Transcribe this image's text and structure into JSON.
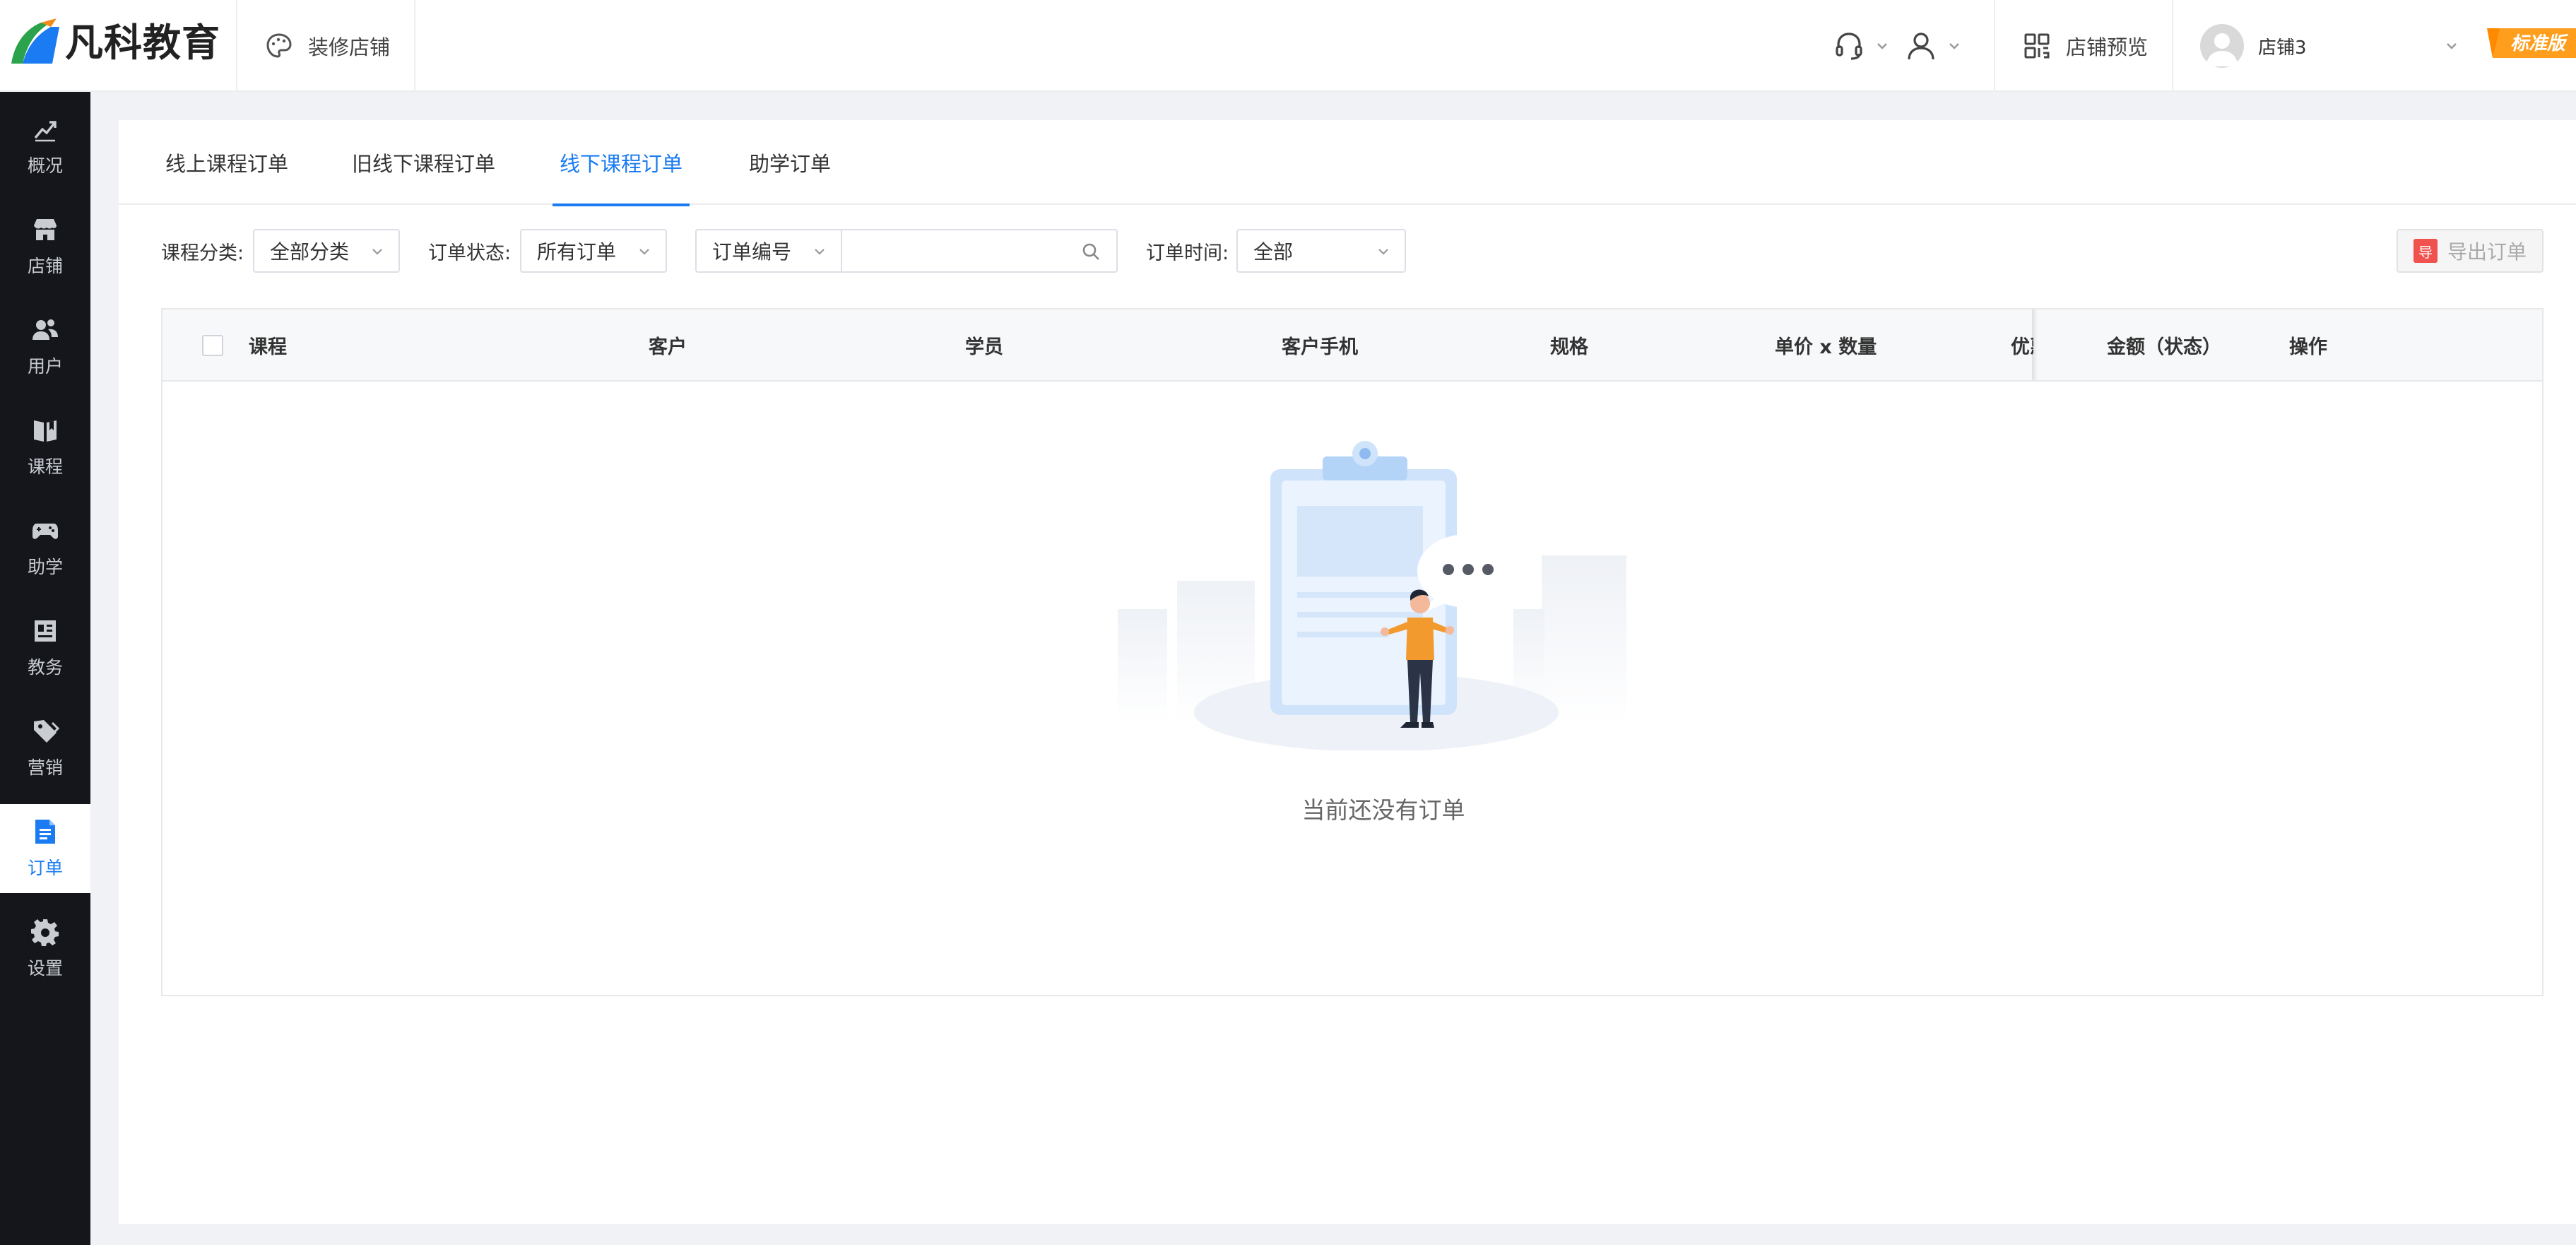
{
  "header": {
    "logo_text": "凡科教育",
    "decor_label": "装修店铺",
    "preview_label": "店铺预览",
    "shop_name": "店铺3",
    "edition_badge": "标准版",
    "colors": {
      "accent": "#1a7bf2",
      "badge": "#ff8a00"
    }
  },
  "sidebar": {
    "items": [
      {
        "label": "概况",
        "icon": "chart-trend-icon"
      },
      {
        "label": "店铺",
        "icon": "store-icon"
      },
      {
        "label": "用户",
        "icon": "users-icon"
      },
      {
        "label": "课程",
        "icon": "book-icon"
      },
      {
        "label": "助学",
        "icon": "gamepad-icon"
      },
      {
        "label": "教务",
        "icon": "calendar-icon"
      },
      {
        "label": "营销",
        "icon": "tag-icon"
      },
      {
        "label": "订单",
        "icon": "order-doc-icon",
        "active": true
      },
      {
        "label": "设置",
        "icon": "gear-icon"
      }
    ]
  },
  "tabs": [
    {
      "label": "线上课程订单"
    },
    {
      "label": "旧线下课程订单"
    },
    {
      "label": "线下课程订单",
      "active": true
    },
    {
      "label": "助学订单"
    }
  ],
  "filters": {
    "category_label": "课程分类:",
    "category_value": "全部分类",
    "status_label": "订单状态:",
    "status_value": "所有订单",
    "search_field": "订单编号",
    "search_value": "",
    "time_label": "订单时间:",
    "time_value": "全部",
    "export_label": "导出订单",
    "export_icon_text": "导"
  },
  "table": {
    "columns": [
      "课程",
      "客户",
      "学员",
      "客户手机",
      "规格",
      "单价 x 数量",
      "优惠",
      "金额（状态）",
      "操作"
    ],
    "rows": [],
    "empty_text": "当前还没有订单"
  }
}
